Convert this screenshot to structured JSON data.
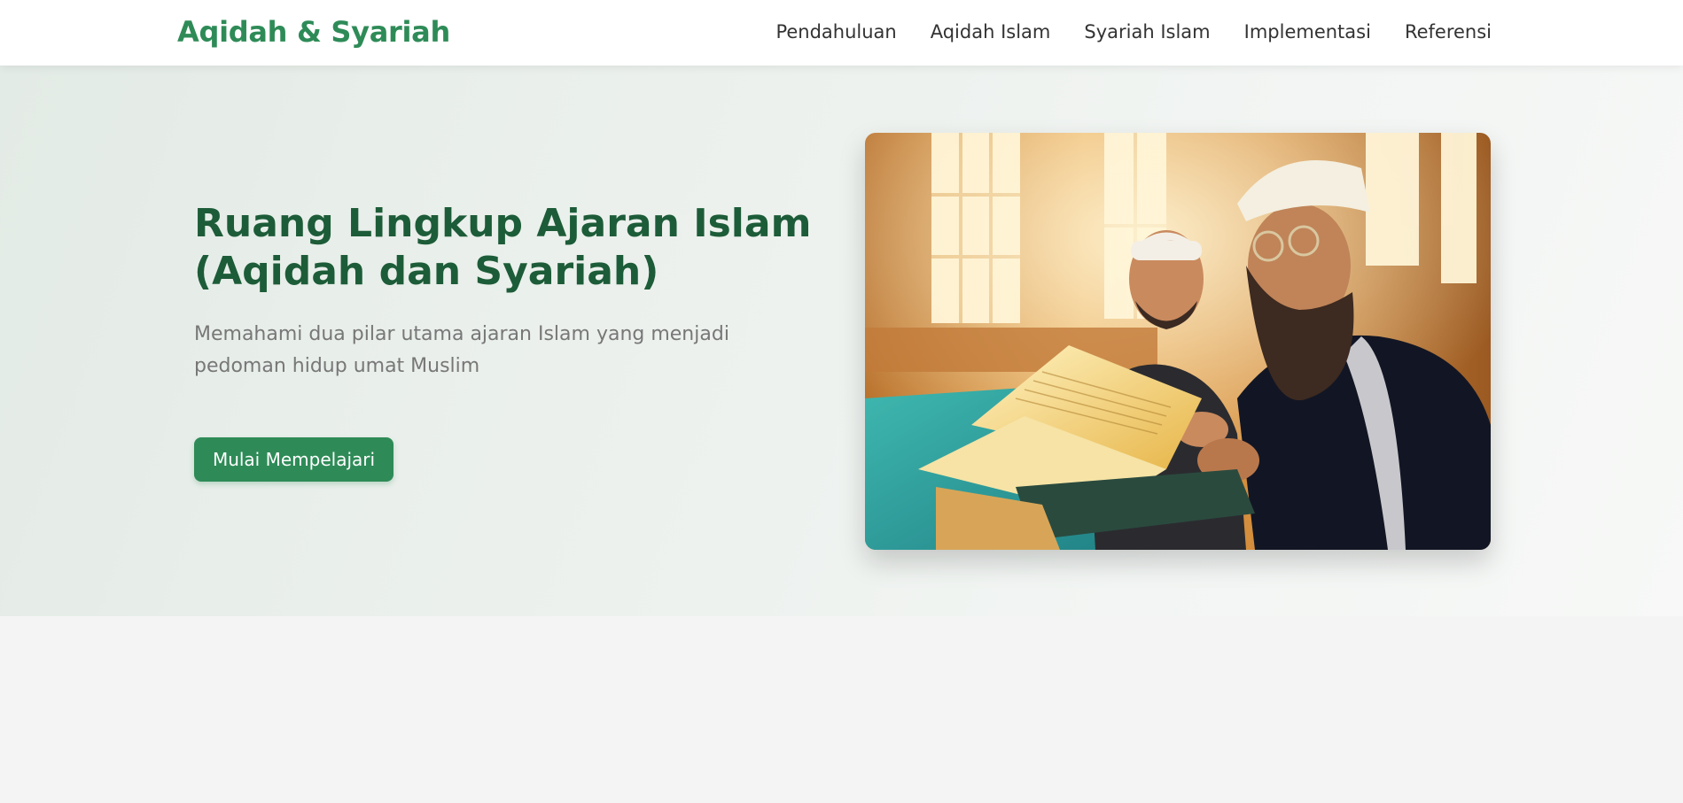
{
  "brand": {
    "name": "Aqidah & Syariah"
  },
  "nav": {
    "items": [
      {
        "label": "Pendahuluan"
      },
      {
        "label": "Aqidah Islam"
      },
      {
        "label": "Syariah Islam"
      },
      {
        "label": "Implementasi"
      },
      {
        "label": "Referensi"
      }
    ]
  },
  "hero": {
    "title": "Ruang Lingkup Ajaran Islam (Aqidah dan Syariah)",
    "subtitle": "Memahami dua pilar utama ajaran Islam yang menjadi pedoman hidup umat Muslim",
    "cta_label": "Mulai Mempelajari"
  },
  "colors": {
    "primary": "#2e8b57",
    "heading": "#1d5c38",
    "text_muted": "#777777",
    "nav_text": "#333333"
  }
}
